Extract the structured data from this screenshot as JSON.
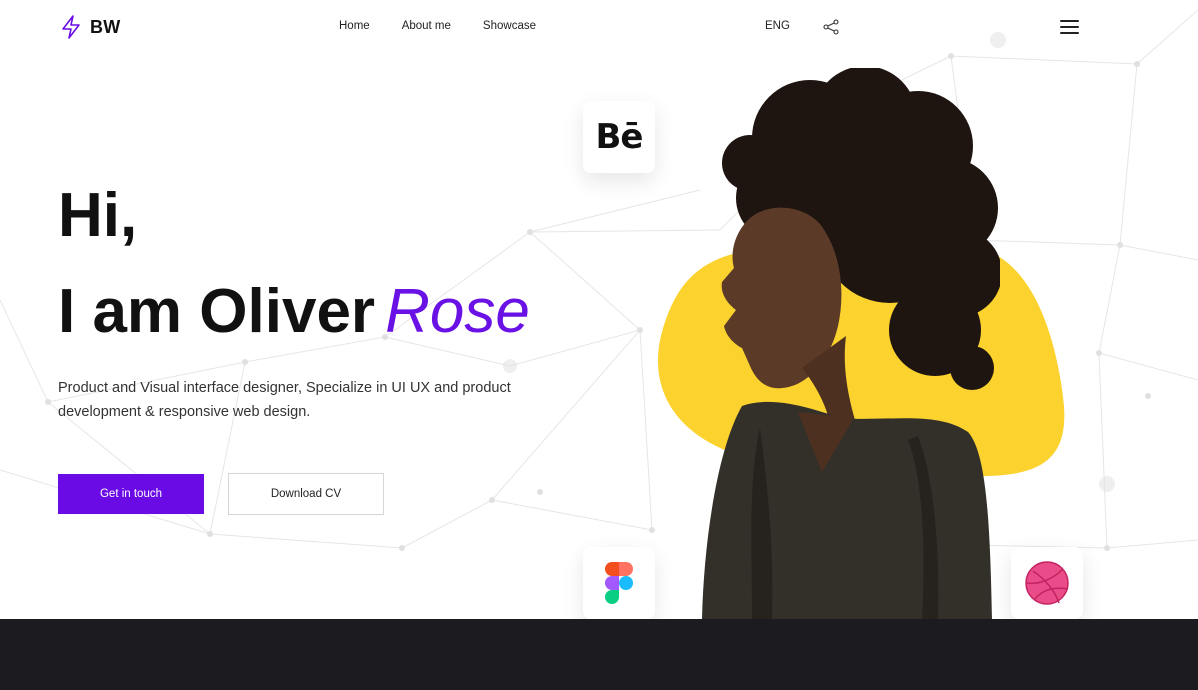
{
  "header": {
    "logo_text": "BW",
    "nav": [
      "Home",
      "About me",
      "Showcase"
    ],
    "language": "ENG"
  },
  "hero": {
    "greeting": "Hi,",
    "name_prefix": "I am Oliver",
    "name_accent": "Rose",
    "description": "Product and Visual interface designer, Specialize in UI UX and product development & responsive web design.",
    "cta_primary": "Get in touch",
    "cta_secondary": "Download CV"
  },
  "cards": {
    "behance_glyph": "Bē"
  },
  "colors": {
    "accent": "#6a0be6",
    "blob": "#fbd22e",
    "dark_band": "#1c1c20",
    "behance": "#111111",
    "dribbble": "#ea4c89"
  },
  "icons": [
    "lightning-logo-icon",
    "share-icon",
    "menu-icon",
    "behance-icon",
    "figma-icon",
    "dribbble-icon"
  ]
}
